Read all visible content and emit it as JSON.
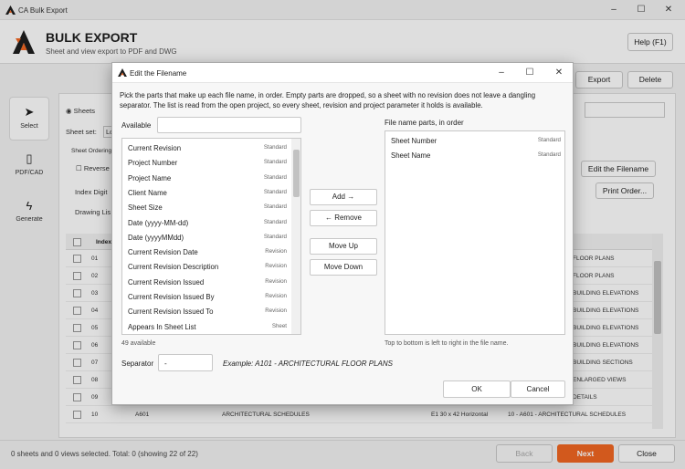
{
  "window": {
    "title": "CA Bulk Export",
    "min_icon": "minimize-icon",
    "max_icon": "maximize-icon",
    "close_icon": "close-icon"
  },
  "header": {
    "app_name": "BULK EXPORT",
    "subtitle": "Sheet and view export to PDF and DWG",
    "help_label": "Help (F1)"
  },
  "sidebar": {
    "items": [
      {
        "label": "Select",
        "icon": "cursor-icon"
      },
      {
        "label": "PDF/CAD",
        "icon": "document-icon"
      },
      {
        "label": "Generate",
        "icon": "lightning-icon"
      }
    ]
  },
  "toolbar": {
    "export_label": "Export",
    "delete_label": "Delete"
  },
  "background": {
    "sheets_radio": "Sheets",
    "sheet_set_label": "Sheet set:",
    "sheet_set_value": "Lo",
    "sheet_ordering_label": "Sheet Ordering",
    "reverse_label": "Reverse",
    "index_digits_label": "Index Digit",
    "drawing_list_label": "Drawing Lis",
    "edit_filename_btn": "Edit the Filename",
    "print_order_btn": "Print Order...",
    "col_index": "Index",
    "rows": [
      {
        "index": "01",
        "name": "",
        "format": "",
        "file": "FLOOR PLANS"
      },
      {
        "index": "02",
        "name": "",
        "format": "",
        "file": "FLOOR PLANS"
      },
      {
        "index": "03",
        "name": "",
        "format": "",
        "file": "BUILDING ELEVATIONS"
      },
      {
        "index": "04",
        "name": "",
        "format": "",
        "file": "BUILDING ELEVATIONS"
      },
      {
        "index": "05",
        "name": "",
        "format": "",
        "file": "BUILDING ELEVATIONS"
      },
      {
        "index": "06",
        "name": "",
        "format": "",
        "file": "BUILDING ELEVATIONS"
      },
      {
        "index": "07",
        "name": "",
        "format": "",
        "file": "BUILDING SECTIONS"
      },
      {
        "index": "08",
        "name": "",
        "format": "",
        "file": "ENLARGED VIEWS"
      },
      {
        "index": "09",
        "name": "",
        "format": "",
        "file": "DETAILS"
      },
      {
        "index": "10",
        "number": "A601",
        "name": "ARCHITECTURAL SCHEDULES",
        "format": "E1 30 x 42 Horizontal",
        "file": "10 - A601 - ARCHITECTURAL SCHEDULES"
      }
    ]
  },
  "footer": {
    "status": "0 sheets and 0 views selected. Total: 0  (showing 22 of 22)",
    "back_label": "Back",
    "next_label": "Next",
    "close_label": "Close"
  },
  "dialog": {
    "title": "Edit the Filename",
    "description": "Pick the parts that make up each file name, in order. Empty parts are dropped, so a sheet with no revision does not leave a dangling separator. The list is read from the open project, so every sheet, revision and project parameter it holds is available.",
    "available_label": "Available",
    "available_search": "",
    "available_items": [
      {
        "name": "Current Revision",
        "category": "Standard"
      },
      {
        "name": "Project Number",
        "category": "Standard"
      },
      {
        "name": "Project Name",
        "category": "Standard"
      },
      {
        "name": "Client Name",
        "category": "Standard"
      },
      {
        "name": "Sheet Size",
        "category": "Standard"
      },
      {
        "name": "Date (yyyy-MM-dd)",
        "category": "Standard"
      },
      {
        "name": "Date (yyyyMMdd)",
        "category": "Standard"
      },
      {
        "name": "Current Revision Date",
        "category": "Revision"
      },
      {
        "name": "Current Revision Description",
        "category": "Revision"
      },
      {
        "name": "Current Revision Issued",
        "category": "Revision"
      },
      {
        "name": "Current Revision Issued By",
        "category": "Revision"
      },
      {
        "name": "Current Revision Issued To",
        "category": "Revision"
      },
      {
        "name": "Appears In Sheet List",
        "category": "Sheet"
      }
    ],
    "available_count": "49 available",
    "add_label": "Add →",
    "remove_label": "← Remove",
    "move_up_label": "Move Up",
    "move_down_label": "Move Down",
    "parts_label": "File name parts, in order",
    "parts": [
      {
        "name": "Sheet Number",
        "category": "Standard"
      },
      {
        "name": "Sheet Name",
        "category": "Standard"
      }
    ],
    "parts_hint": "Top to bottom is left to right in the file name.",
    "separator_label": "Separator",
    "separator_value": "-",
    "example": "Example:  A101 - ARCHITECTURAL FLOOR PLANS",
    "ok_label": "OK",
    "cancel_label": "Cancel"
  },
  "colors": {
    "accent": "#f26722",
    "logo_dark": "#1e1e1e"
  }
}
